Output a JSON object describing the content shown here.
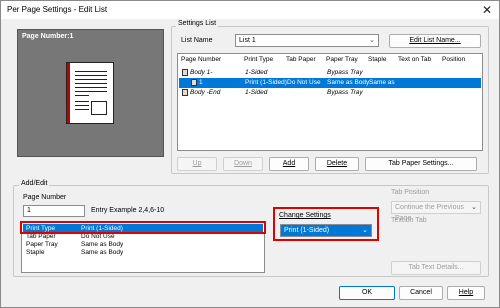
{
  "window": {
    "title": "Per Page Settings - Edit List",
    "close_glyph": "✕"
  },
  "preview": {
    "caption": "Page Number:1"
  },
  "settings_list": {
    "group_label": "Settings List",
    "list_name_label": "List Name",
    "list_name_value": "List 1",
    "edit_list_name_button": "Edit List Name...",
    "columns": [
      "Page Number",
      "Print Type",
      "Tab Paper",
      "Paper Tray",
      "Staple",
      "Text on Tab",
      "Position"
    ],
    "rows": [
      {
        "page": "Body 1-",
        "print_type": "1-Sided",
        "tab_paper": "",
        "paper_tray": "Bypass Tray",
        "staple": "",
        "selected": false,
        "italic": true,
        "indent": false
      },
      {
        "page": "1",
        "print_type": "Print (1-Sided)",
        "tab_paper": "Do Not Use",
        "paper_tray": "Same as Body",
        "staple": "Same as",
        "selected": true,
        "italic": false,
        "indent": true
      },
      {
        "page": "Body -End",
        "print_type": "1-Sided",
        "tab_paper": "",
        "paper_tray": "Bypass Tray",
        "staple": "",
        "selected": false,
        "italic": true,
        "indent": false
      }
    ],
    "up_button": "Up",
    "down_button": "Down",
    "add_button": "Add",
    "delete_button": "Delete",
    "tab_paper_settings_button": "Tab Paper Settings..."
  },
  "add_edit": {
    "group_label": "Add/Edit",
    "page_number_label": "Page Number",
    "page_number_value": "1",
    "entry_example": "Entry Example 2,4,6-10",
    "items": [
      {
        "name": "Print Type",
        "value": "Print (1-Sided)",
        "selected": true
      },
      {
        "name": "Tab Paper",
        "value": "Do Not Use",
        "selected": false
      },
      {
        "name": "Paper Tray",
        "value": "Same as Body",
        "selected": false
      },
      {
        "name": "Staple",
        "value": "Same as Body",
        "selected": false
      }
    ],
    "change_settings_label": "Change Settings",
    "change_settings_value": "Print (1-Sided)",
    "tab_position_label": "Tab Position",
    "tab_position_value": "Continue the Previous Page",
    "text_on_tab_label": "Text on Tab",
    "tab_text_details_button": "Tab Text Details..."
  },
  "footer": {
    "ok": "OK",
    "cancel": "Cancel",
    "help": "Help"
  },
  "colors": {
    "selection": "#0078d7",
    "highlight_box": "#e00000",
    "preview_bg": "#777777"
  }
}
